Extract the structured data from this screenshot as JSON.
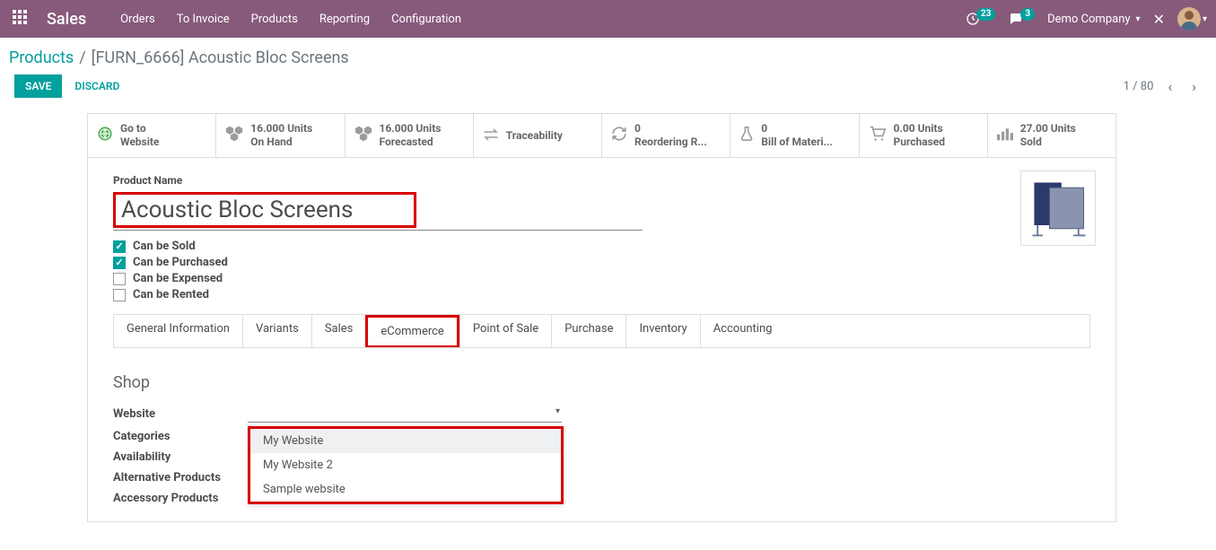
{
  "header": {
    "app_title": "Sales",
    "menu": [
      "Orders",
      "To Invoice",
      "Products",
      "Reporting",
      "Configuration"
    ],
    "clock_badge": "23",
    "chat_badge": "3",
    "company": "Demo Company",
    "company_caret": "▾"
  },
  "breadcrumb": {
    "root": "Products",
    "current": "[FURN_6666] Acoustic Bloc Screens"
  },
  "actions": {
    "save": "SAVE",
    "discard": "DISCARD",
    "pager": "1 / 80"
  },
  "stats": {
    "goto": {
      "l1": "Go to",
      "l2": "Website"
    },
    "onhand": {
      "l1": "16.000 Units",
      "l2": "On Hand"
    },
    "forecast": {
      "l1": "16.000 Units",
      "l2": "Forecasted"
    },
    "trace": {
      "l1": "Traceability",
      "l2": ""
    },
    "reorder": {
      "l1": "0",
      "l2": "Reordering R..."
    },
    "bom": {
      "l1": "0",
      "l2": "Bill of Materi..."
    },
    "purchased": {
      "l1": "0.00 Units",
      "l2": "Purchased"
    },
    "sold": {
      "l1": "27.00 Units",
      "l2": "Sold"
    }
  },
  "form": {
    "name_label": "Product Name",
    "name_value": "Acoustic Bloc Screens",
    "checks": {
      "sold": "Can be Sold",
      "purchased": "Can be Purchased",
      "expensed": "Can be Expensed",
      "rented": "Can be Rented"
    }
  },
  "tabs": [
    "General Information",
    "Variants",
    "Sales",
    "eCommerce",
    "Point of Sale",
    "Purchase",
    "Inventory",
    "Accounting"
  ],
  "shop": {
    "title": "Shop",
    "fields": {
      "website": "Website",
      "categories": "Categories",
      "availability": "Availability",
      "alt": "Alternative Products",
      "acc": "Accessory Products"
    },
    "dropdown": [
      "My Website",
      "My Website 2",
      "Sample website"
    ]
  }
}
